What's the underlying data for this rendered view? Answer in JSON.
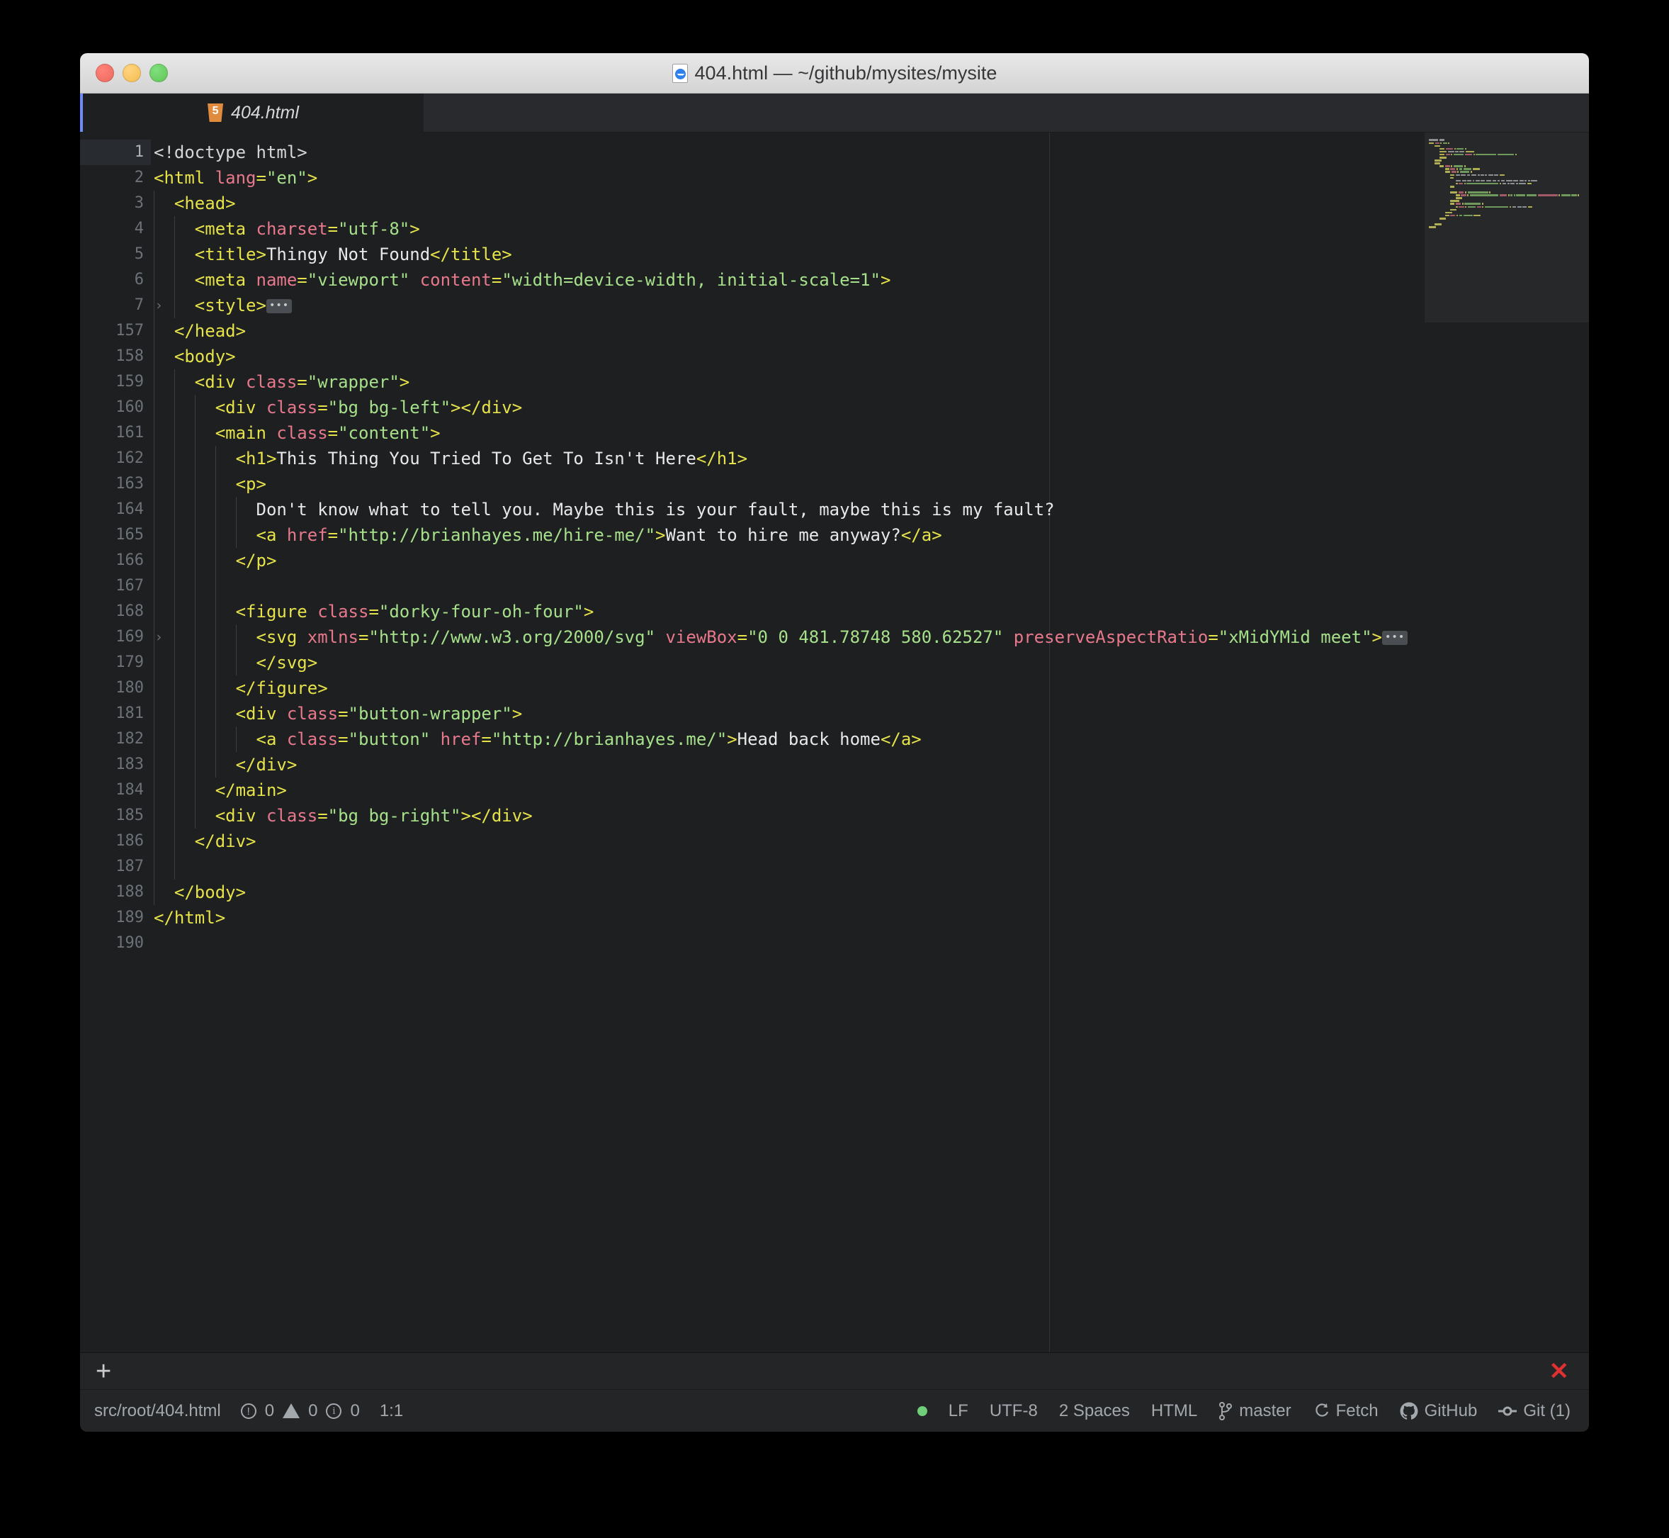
{
  "window": {
    "title": "404.html — ~/github/mysites/mysite",
    "doc_icon": "document-icon",
    "traffic_lights": [
      "close",
      "minimize",
      "zoom"
    ]
  },
  "tabs": [
    {
      "label": "404.html",
      "icon": "html5-icon",
      "active": true
    }
  ],
  "editor": {
    "language": "HTML",
    "lines": [
      {
        "num": "1",
        "indent": 0,
        "fold": false,
        "active": true,
        "tokens": [
          {
            "t": "plain",
            "v": "<!doctype html>"
          }
        ]
      },
      {
        "num": "2",
        "indent": 0,
        "fold": false,
        "tokens": [
          {
            "t": "tag",
            "v": "<html "
          },
          {
            "t": "attr",
            "v": "lang"
          },
          {
            "t": "tag",
            "v": "="
          },
          {
            "t": "str",
            "v": "\"en\""
          },
          {
            "t": "tag",
            "v": ">"
          }
        ]
      },
      {
        "num": "3",
        "indent": 1,
        "fold": false,
        "tokens": [
          {
            "t": "tag",
            "v": "<head>"
          }
        ]
      },
      {
        "num": "4",
        "indent": 2,
        "fold": false,
        "tokens": [
          {
            "t": "tag",
            "v": "<meta "
          },
          {
            "t": "attr",
            "v": "charset"
          },
          {
            "t": "tag",
            "v": "="
          },
          {
            "t": "str",
            "v": "\"utf-8\""
          },
          {
            "t": "tag",
            "v": ">"
          }
        ]
      },
      {
        "num": "5",
        "indent": 2,
        "fold": false,
        "tokens": [
          {
            "t": "tag",
            "v": "<title>"
          },
          {
            "t": "txt",
            "v": "Thingy Not Found"
          },
          {
            "t": "tag",
            "v": "</title>"
          }
        ]
      },
      {
        "num": "6",
        "indent": 2,
        "fold": false,
        "tokens": [
          {
            "t": "tag",
            "v": "<meta "
          },
          {
            "t": "attr",
            "v": "name"
          },
          {
            "t": "tag",
            "v": "="
          },
          {
            "t": "str",
            "v": "\"viewport\""
          },
          {
            "t": "plain",
            "v": " "
          },
          {
            "t": "attr",
            "v": "content"
          },
          {
            "t": "tag",
            "v": "="
          },
          {
            "t": "str",
            "v": "\"width=device-width, initial-scale=1\""
          },
          {
            "t": "tag",
            "v": ">"
          }
        ]
      },
      {
        "num": "7",
        "indent": 2,
        "fold": true,
        "folded": true,
        "tokens": [
          {
            "t": "tag",
            "v": "<style>"
          },
          {
            "t": "chip",
            "v": "•••"
          }
        ]
      },
      {
        "num": "157",
        "indent": 1,
        "fold": false,
        "tokens": [
          {
            "t": "tag",
            "v": "</head>"
          }
        ]
      },
      {
        "num": "158",
        "indent": 1,
        "fold": false,
        "tokens": [
          {
            "t": "tag",
            "v": "<body>"
          }
        ]
      },
      {
        "num": "159",
        "indent": 2,
        "fold": false,
        "tokens": [
          {
            "t": "tag",
            "v": "<div "
          },
          {
            "t": "attr",
            "v": "class"
          },
          {
            "t": "tag",
            "v": "="
          },
          {
            "t": "str",
            "v": "\"wrapper\""
          },
          {
            "t": "tag",
            "v": ">"
          }
        ]
      },
      {
        "num": "160",
        "indent": 3,
        "fold": false,
        "tokens": [
          {
            "t": "tag",
            "v": "<div "
          },
          {
            "t": "attr",
            "v": "class"
          },
          {
            "t": "tag",
            "v": "="
          },
          {
            "t": "str",
            "v": "\"bg bg-left\""
          },
          {
            "t": "tag",
            "v": "></div>"
          }
        ]
      },
      {
        "num": "161",
        "indent": 3,
        "fold": false,
        "tokens": [
          {
            "t": "tag",
            "v": "<main "
          },
          {
            "t": "attr",
            "v": "class"
          },
          {
            "t": "tag",
            "v": "="
          },
          {
            "t": "str",
            "v": "\"content\""
          },
          {
            "t": "tag",
            "v": ">"
          }
        ]
      },
      {
        "num": "162",
        "indent": 4,
        "fold": false,
        "tokens": [
          {
            "t": "tag",
            "v": "<h1>"
          },
          {
            "t": "txt",
            "v": "This Thing You Tried To Get To Isn't Here"
          },
          {
            "t": "tag",
            "v": "</h1>"
          }
        ]
      },
      {
        "num": "163",
        "indent": 4,
        "fold": false,
        "tokens": [
          {
            "t": "tag",
            "v": "<p>"
          }
        ]
      },
      {
        "num": "164",
        "indent": 5,
        "fold": false,
        "tokens": [
          {
            "t": "txt",
            "v": "Don't know what to tell you. Maybe this is your fault, maybe this is my fault?"
          }
        ]
      },
      {
        "num": "165",
        "indent": 5,
        "fold": false,
        "tokens": [
          {
            "t": "tag",
            "v": "<a "
          },
          {
            "t": "attr",
            "v": "href"
          },
          {
            "t": "tag",
            "v": "="
          },
          {
            "t": "str",
            "v": "\"http://brianhayes.me/hire-me/\""
          },
          {
            "t": "tag",
            "v": ">"
          },
          {
            "t": "txt",
            "v": "Want to hire me anyway?"
          },
          {
            "t": "tag",
            "v": "</a>"
          }
        ]
      },
      {
        "num": "166",
        "indent": 4,
        "fold": false,
        "tokens": [
          {
            "t": "tag",
            "v": "</p>"
          }
        ]
      },
      {
        "num": "167",
        "indent": 4,
        "fold": false,
        "tokens": []
      },
      {
        "num": "168",
        "indent": 4,
        "fold": false,
        "tokens": [
          {
            "t": "tag",
            "v": "<figure "
          },
          {
            "t": "attr",
            "v": "class"
          },
          {
            "t": "tag",
            "v": "="
          },
          {
            "t": "str",
            "v": "\"dorky-four-oh-four\""
          },
          {
            "t": "tag",
            "v": ">"
          }
        ]
      },
      {
        "num": "169",
        "indent": 5,
        "fold": true,
        "folded": true,
        "tokens": [
          {
            "t": "tag",
            "v": "<svg "
          },
          {
            "t": "attr",
            "v": "xmlns"
          },
          {
            "t": "tag",
            "v": "="
          },
          {
            "t": "str",
            "v": "\"http://www.w3.org/2000/svg\""
          },
          {
            "t": "plain",
            "v": " "
          },
          {
            "t": "attr",
            "v": "viewBox"
          },
          {
            "t": "tag",
            "v": "="
          },
          {
            "t": "str",
            "v": "\"0 0 481.78748 580.62527\""
          },
          {
            "t": "plain",
            "v": " "
          },
          {
            "t": "attr",
            "v": "preserveAspectRatio"
          },
          {
            "t": "tag",
            "v": "="
          },
          {
            "t": "str",
            "v": "\"xMidYMid meet\""
          },
          {
            "t": "tag",
            "v": ">"
          },
          {
            "t": "chip",
            "v": "•••"
          }
        ]
      },
      {
        "num": "179",
        "indent": 5,
        "fold": false,
        "tokens": [
          {
            "t": "tag",
            "v": "</svg>"
          }
        ]
      },
      {
        "num": "180",
        "indent": 4,
        "fold": false,
        "tokens": [
          {
            "t": "tag",
            "v": "</figure>"
          }
        ]
      },
      {
        "num": "181",
        "indent": 4,
        "fold": false,
        "tokens": [
          {
            "t": "tag",
            "v": "<div "
          },
          {
            "t": "attr",
            "v": "class"
          },
          {
            "t": "tag",
            "v": "="
          },
          {
            "t": "str",
            "v": "\"button-wrapper\""
          },
          {
            "t": "tag",
            "v": ">"
          }
        ]
      },
      {
        "num": "182",
        "indent": 5,
        "fold": false,
        "tokens": [
          {
            "t": "tag",
            "v": "<a "
          },
          {
            "t": "attr",
            "v": "class"
          },
          {
            "t": "tag",
            "v": "="
          },
          {
            "t": "str",
            "v": "\"button\""
          },
          {
            "t": "plain",
            "v": " "
          },
          {
            "t": "attr",
            "v": "href"
          },
          {
            "t": "tag",
            "v": "="
          },
          {
            "t": "str",
            "v": "\"http://brianhayes.me/\""
          },
          {
            "t": "tag",
            "v": ">"
          },
          {
            "t": "txt",
            "v": "Head back home"
          },
          {
            "t": "tag",
            "v": "</a>"
          }
        ]
      },
      {
        "num": "183",
        "indent": 4,
        "fold": false,
        "tokens": [
          {
            "t": "tag",
            "v": "</div>"
          }
        ]
      },
      {
        "num": "184",
        "indent": 3,
        "fold": false,
        "tokens": [
          {
            "t": "tag",
            "v": "</main>"
          }
        ]
      },
      {
        "num": "185",
        "indent": 3,
        "fold": false,
        "tokens": [
          {
            "t": "tag",
            "v": "<div "
          },
          {
            "t": "attr",
            "v": "class"
          },
          {
            "t": "tag",
            "v": "="
          },
          {
            "t": "str",
            "v": "\"bg bg-right\""
          },
          {
            "t": "tag",
            "v": "></div>"
          }
        ]
      },
      {
        "num": "186",
        "indent": 2,
        "fold": false,
        "tokens": [
          {
            "t": "tag",
            "v": "</div>"
          }
        ]
      },
      {
        "num": "187",
        "indent": 2,
        "fold": false,
        "tokens": []
      },
      {
        "num": "188",
        "indent": 1,
        "fold": false,
        "tokens": [
          {
            "t": "tag",
            "v": "</body>"
          }
        ]
      },
      {
        "num": "189",
        "indent": 0,
        "fold": false,
        "tokens": [
          {
            "t": "tag",
            "v": "</html>"
          }
        ]
      },
      {
        "num": "190",
        "indent": 0,
        "fold": false,
        "tokens": []
      }
    ]
  },
  "bottom_panel": {
    "add_label": "+",
    "close_label": "✕"
  },
  "statusbar": {
    "file_path": "src/root/404.html",
    "errors": "0",
    "warnings": "0",
    "infos": "0",
    "cursor": "1:1",
    "live_dot": "green",
    "line_ending": "LF",
    "encoding": "UTF-8",
    "indentation": "2 Spaces",
    "grammar": "HTML",
    "branch": "master",
    "fetch": "Fetch",
    "github": "GitHub",
    "git": "Git (1)"
  },
  "colors": {
    "background": "#1d1f21",
    "tab_accent": "#6a8cff",
    "tag": "#e6e24a",
    "attribute": "#e8788c",
    "string": "#a6e08a",
    "text": "#e8e8e8",
    "close_x": "#e03131",
    "status_dot": "#6fcf79"
  }
}
